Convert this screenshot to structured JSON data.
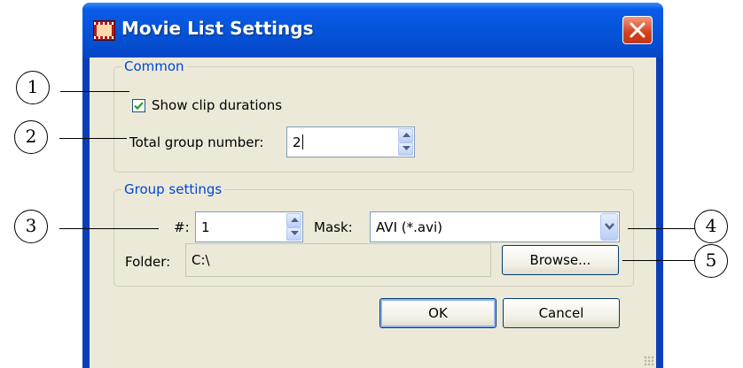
{
  "window": {
    "title": "Movie List Settings",
    "icon": "film-strip-icon",
    "close_icon": "close-icon"
  },
  "common": {
    "legend": "Common",
    "show_clip_durations": {
      "label": "Show clip durations",
      "checked": true
    },
    "total_group_number": {
      "label": "Total group number:",
      "value": "2"
    }
  },
  "group_settings": {
    "legend": "Group settings",
    "number": {
      "label": "#:",
      "value": "1"
    },
    "mask": {
      "label": "Mask:",
      "value": "AVI (*.avi)"
    },
    "folder": {
      "label": "Folder:",
      "value": "C:\\"
    },
    "browse_label": "Browse..."
  },
  "buttons": {
    "ok": "OK",
    "cancel": "Cancel"
  },
  "callouts": [
    "1",
    "2",
    "3",
    "4",
    "5"
  ],
  "colors": {
    "title_bar": "#0553d8",
    "client": "#ece9d8",
    "legend_text": "#0046d5",
    "close_button": "#d4401e"
  }
}
